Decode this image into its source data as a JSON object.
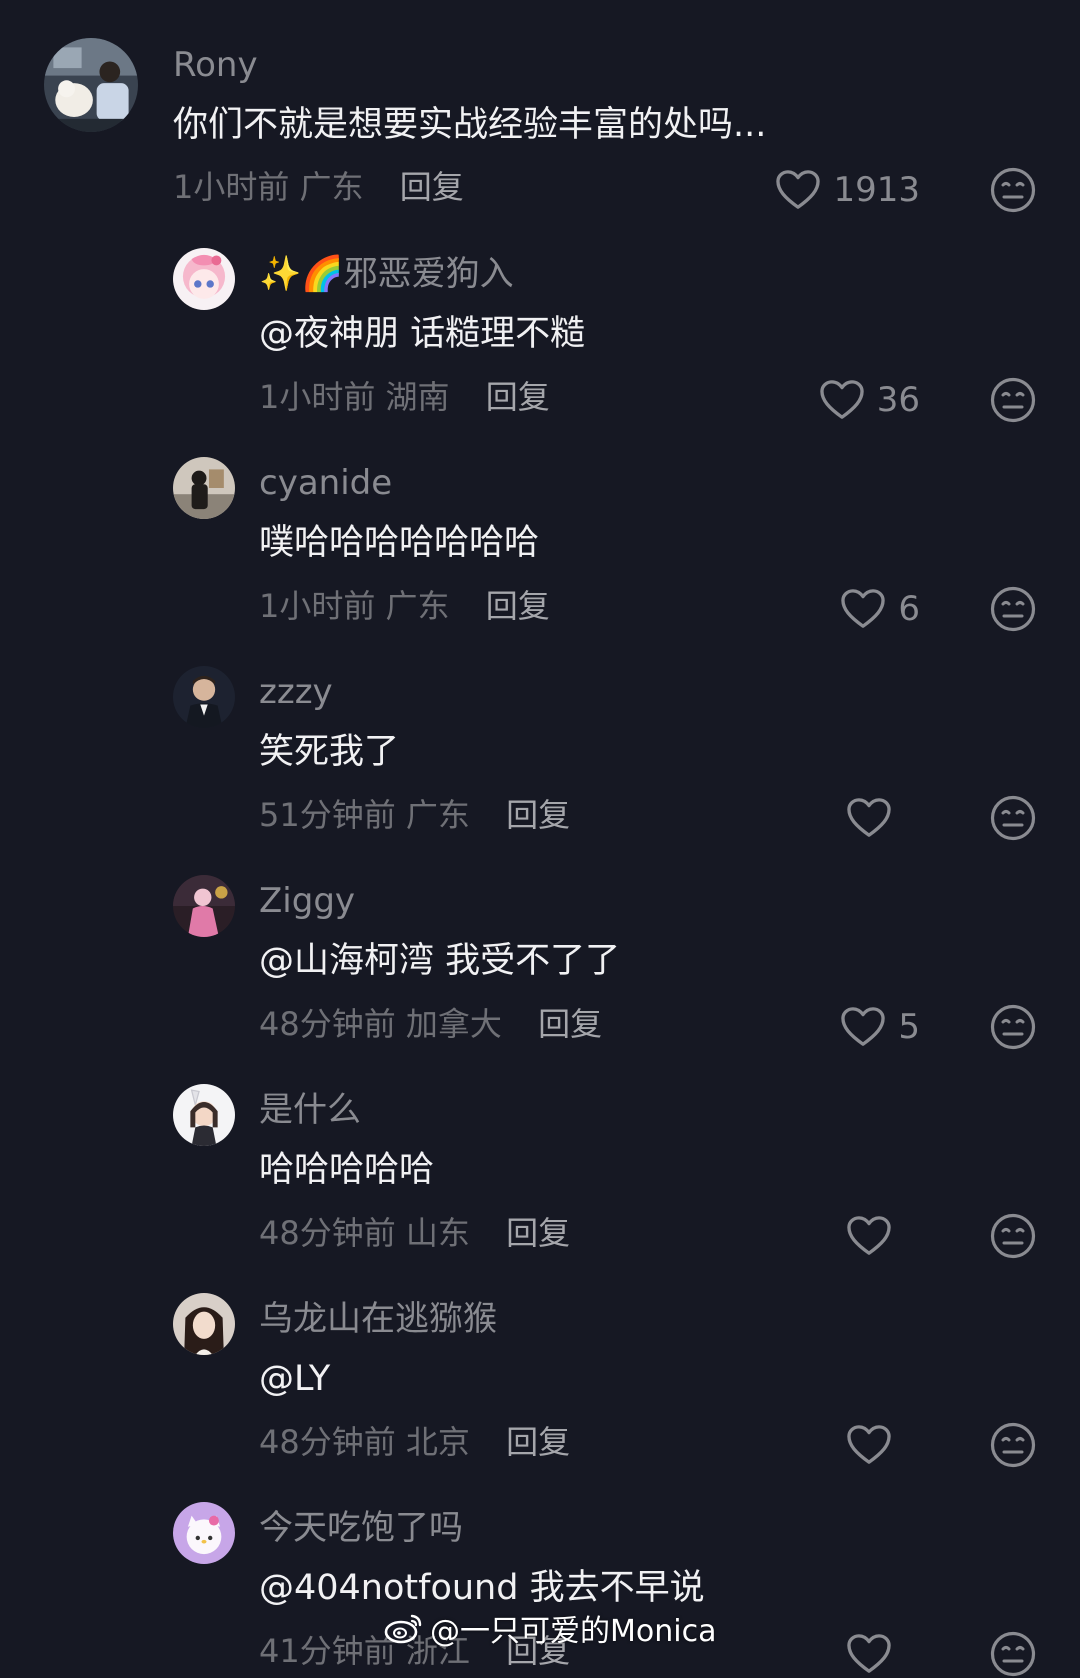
{
  "colors": {
    "background": "#161823",
    "username": "#8a8b91",
    "text": "#f1f1f3",
    "meta": "#6f7076",
    "reply": "#a5a6ab"
  },
  "comments": [
    {
      "username": "Rony",
      "text": "你们不就是想要实战经验丰富的处吗...",
      "time": "1小时前",
      "location": "广东",
      "reply": "回复",
      "likes": "1913",
      "avatar_icon": "avatar-person-with-dog"
    },
    {
      "username": "✨🌈邪恶爱狗入",
      "text": "@夜神朋 话糙理不糙",
      "time": "1小时前",
      "location": "湖南",
      "reply": "回复",
      "likes": "36",
      "avatar_icon": "avatar-pink-cartoon"
    },
    {
      "username": "cyanide",
      "text": "噗哈哈哈哈哈哈哈",
      "time": "1小时前",
      "location": "广东",
      "reply": "回复",
      "likes": "6",
      "avatar_icon": "avatar-person-photo"
    },
    {
      "username": "zzzy",
      "text": "笑死我了",
      "time": "51分钟前",
      "location": "广东",
      "reply": "回复",
      "likes": "",
      "avatar_icon": "avatar-man-in-suit"
    },
    {
      "username": "Ziggy",
      "text": "@山海柯湾 我受不了了",
      "time": "48分钟前",
      "location": "加拿大",
      "reply": "回复",
      "likes": "5",
      "avatar_icon": "avatar-pink-photo"
    },
    {
      "username": "是什么",
      "text": "哈哈哈哈哈",
      "time": "48分钟前",
      "location": "山东",
      "reply": "回复",
      "likes": "",
      "avatar_icon": "avatar-anime-girl"
    },
    {
      "username": "乌龙山在逃猕猴",
      "text": "@LY",
      "time": "48分钟前",
      "location": "北京",
      "reply": "回复",
      "likes": "",
      "avatar_icon": "avatar-woman-photo"
    },
    {
      "username": "今天吃饱了吗",
      "text": "@404notfound 我去不早说",
      "time": "41分钟前",
      "location": "浙江",
      "reply": "回复",
      "likes": "",
      "avatar_icon": "avatar-hello-kitty"
    }
  ],
  "icons": {
    "like": "heart-outline-icon",
    "dislike": "neutral-face-icon"
  },
  "watermark": {
    "text": "@一只可爱的Monica",
    "icon": "weibo-logo-icon"
  }
}
